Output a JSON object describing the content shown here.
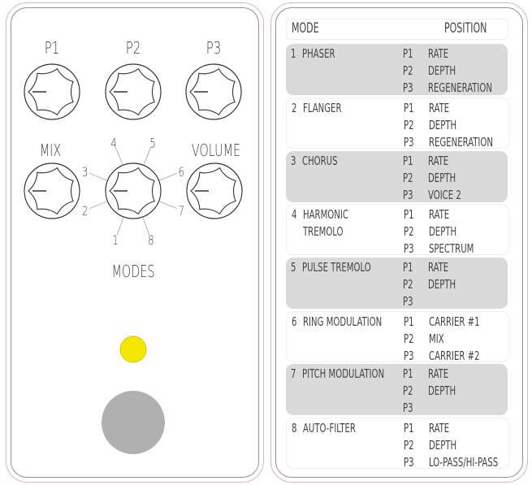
{
  "pedal": {
    "top_knobs": [
      {
        "label": "P1"
      },
      {
        "label": "P2"
      },
      {
        "label": "P3"
      }
    ],
    "mix_label": "MIX",
    "volume_label": "VOLUME",
    "modes_label": "MODES",
    "mode_positions": [
      "1",
      "2",
      "3",
      "4",
      "5",
      "6",
      "7",
      "8"
    ],
    "led_color": "#f5e800",
    "footswitch_color": "#b0b0b0"
  },
  "legend": {
    "header_mode": "MODE",
    "header_position": "POSITION",
    "modes": [
      {
        "num": "1",
        "name": [
          "PHASER"
        ],
        "params": [
          [
            "P1",
            "RATE"
          ],
          [
            "P2",
            "DEPTH"
          ],
          [
            "P3",
            "REGENERATION"
          ]
        ],
        "shaded": true
      },
      {
        "num": "2",
        "name": [
          "FLANGER"
        ],
        "params": [
          [
            "P1",
            "RATE"
          ],
          [
            "P2",
            "DEPTH"
          ],
          [
            "P3",
            "REGENERATION"
          ]
        ],
        "shaded": false
      },
      {
        "num": "3",
        "name": [
          "CHORUS"
        ],
        "params": [
          [
            "P1",
            "RATE"
          ],
          [
            "P2",
            "DEPTH"
          ],
          [
            "P3",
            "VOICE 2"
          ]
        ],
        "shaded": true
      },
      {
        "num": "4",
        "name": [
          "HARMONIC",
          "TREMOLO"
        ],
        "params": [
          [
            "P1",
            "RATE"
          ],
          [
            "P2",
            "DEPTH"
          ],
          [
            "P3",
            "SPECTRUM"
          ]
        ],
        "shaded": false
      },
      {
        "num": "5",
        "name": [
          "PULSE TREMOLO"
        ],
        "params": [
          [
            "P1",
            "RATE"
          ],
          [
            "P2",
            "DEPTH"
          ],
          [
            "P3",
            ""
          ]
        ],
        "shaded": true
      },
      {
        "num": "6",
        "name": [
          "RING MODULATION"
        ],
        "params": [
          [
            "P1",
            "CARRIER #1"
          ],
          [
            "P2",
            "MIX"
          ],
          [
            "P3",
            "CARRIER #2"
          ]
        ],
        "shaded": false
      },
      {
        "num": "7",
        "name": [
          "PITCH MODULATION"
        ],
        "params": [
          [
            "P1",
            "RATE"
          ],
          [
            "P2",
            "DEPTH"
          ],
          [
            "P3",
            ""
          ]
        ],
        "shaded": true
      },
      {
        "num": "8",
        "name": [
          "AUTO-FILTER"
        ],
        "params": [
          [
            "P1",
            "RATE"
          ],
          [
            "P2",
            "DEPTH"
          ],
          [
            "P3",
            "LO-PASS/HI-PASS"
          ]
        ],
        "shaded": false
      }
    ]
  }
}
